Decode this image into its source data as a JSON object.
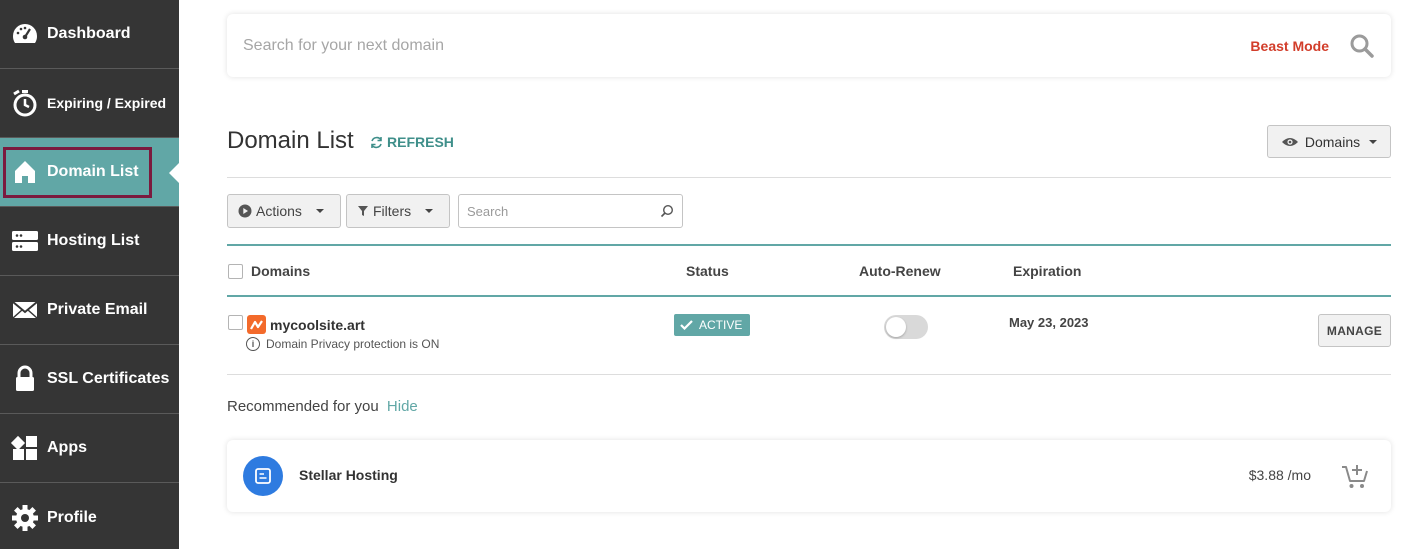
{
  "sidebar": {
    "items": [
      {
        "label": "Dashboard",
        "icon": "speedometer-icon"
      },
      {
        "label": "Expiring / Expired",
        "icon": "timer-icon"
      },
      {
        "label": "Domain List",
        "icon": "home-icon",
        "active": true
      },
      {
        "label": "Hosting List",
        "icon": "server-icon"
      },
      {
        "label": "Private Email",
        "icon": "envelope-icon"
      },
      {
        "label": "SSL Certificates",
        "icon": "lock-icon"
      },
      {
        "label": "Apps",
        "icon": "apps-icon"
      },
      {
        "label": "Profile",
        "icon": "gear-icon"
      }
    ],
    "colors": {
      "background": "#353535",
      "active": "#61a7a6",
      "highlight_border": "#7b1a3e"
    }
  },
  "search": {
    "placeholder": "Search for your next domain",
    "beast_mode_label": "Beast Mode"
  },
  "header": {
    "title": "Domain List",
    "refresh_label": "REFRESH",
    "view_dropdown_label": "Domains"
  },
  "toolbar": {
    "actions_label": "Actions",
    "filters_label": "Filters",
    "search_placeholder": "Search"
  },
  "table": {
    "columns": [
      "Domains",
      "Status",
      "Auto-Renew",
      "Expiration"
    ],
    "rows": [
      {
        "domain": "mycoolsite.art",
        "note": "Domain Privacy protection is ON",
        "status": "ACTIVE",
        "auto_renew": false,
        "expiration": "May 23, 2023",
        "action_label": "MANAGE"
      }
    ]
  },
  "recommended": {
    "title": "Recommended for you",
    "hide_label": "Hide",
    "items": [
      {
        "name": "Stellar Hosting",
        "price": "$3.88 /mo",
        "icon": "hosting-icon"
      }
    ]
  },
  "colors": {
    "accent": "#61a7a6",
    "beast_mode": "#d23d2a",
    "rec_icon_bg": "#2e7be0",
    "domain_logo": "#f36a2b"
  }
}
